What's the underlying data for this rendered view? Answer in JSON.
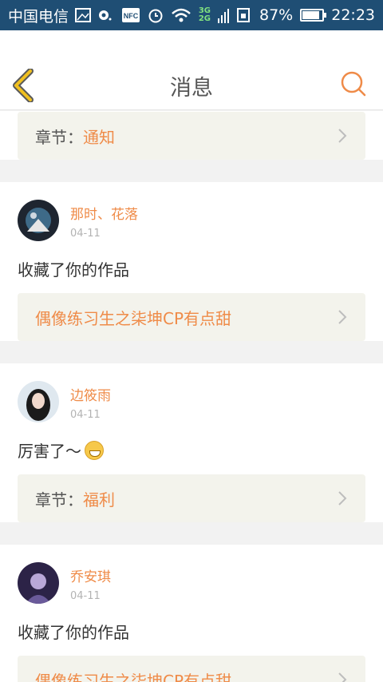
{
  "status_bar": {
    "carrier": "中国电信",
    "nfc": "NFC",
    "net_3g": "3G",
    "net_2g": "2G",
    "battery": "87%",
    "battery_level": 0.87,
    "time": "22:23"
  },
  "header": {
    "title": "消息"
  },
  "items": [
    {
      "link_label": "章节：",
      "link_value": "通知"
    },
    {
      "user": "那时、花落",
      "date": "04-11",
      "message": "收藏了你的作品",
      "link_value": "偶像练习生之柒坤CP有点甜"
    },
    {
      "user": "边筱雨",
      "date": "04-11",
      "message": "厉害了～",
      "link_label": "章节：",
      "link_value": "福利"
    },
    {
      "user": "乔安琪",
      "date": "04-11",
      "message": "收藏了你的作品",
      "link_value": "偶像练习生之柒坤CP有点甜"
    }
  ],
  "colors": {
    "accent": "#ef8b48",
    "status_bar": "#1f4e74",
    "back_arrow": "#f0c020"
  }
}
